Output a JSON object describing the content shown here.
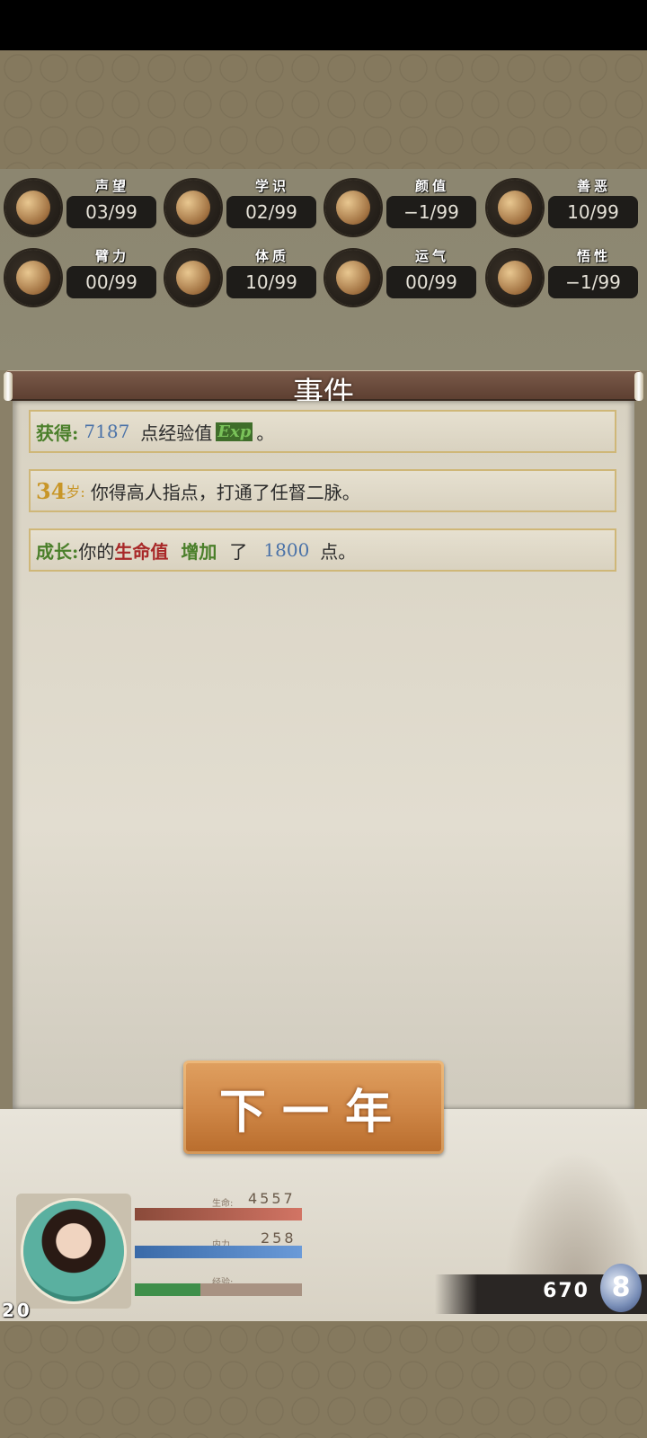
{
  "stats": [
    {
      "name": "声望",
      "value": "03/99",
      "icon": "reputation-icon"
    },
    {
      "name": "学识",
      "value": "02/99",
      "icon": "knowledge-icon"
    },
    {
      "name": "颜值",
      "value": "−1/99",
      "icon": "appearance-icon"
    },
    {
      "name": "善恶",
      "value": "10/99",
      "icon": "morality-icon"
    },
    {
      "name": "臂力",
      "value": "00/99",
      "icon": "strength-icon"
    },
    {
      "name": "体质",
      "value": "10/99",
      "icon": "constitution-icon"
    },
    {
      "name": "运气",
      "value": "00/99",
      "icon": "luck-icon"
    },
    {
      "name": "悟性",
      "value": "−1/99",
      "icon": "comprehension-icon"
    }
  ],
  "events_panel": {
    "title": "事件",
    "events": [
      {
        "prefix": "获得:",
        "num": "7187",
        "text1": "点经验值",
        "badge": "Exp",
        "text2": "。"
      },
      {
        "age": "34",
        "age_unit": "岁:",
        "text": "你得高人指点，打通了任督二脉。"
      },
      {
        "prefix": "成长:",
        "text1": "你的",
        "highlight": "生命值",
        "action": "增加",
        "text2": "了",
        "num": "1800",
        "text3": "点。"
      }
    ]
  },
  "next_button_label": "下一年",
  "character": {
    "level": "20",
    "hp_label": "生命:",
    "hp_value": "4557",
    "mp_label": "内力",
    "mp_value": "258",
    "exp_label": "经验:",
    "hp_fill": 1.0,
    "mp_fill": 1.0,
    "exp_fill": 0.39
  },
  "currency": {
    "value": "670",
    "icon": "silver-coin-icon"
  },
  "colors": {
    "hp": "#c8685a",
    "mp": "#5a8cc8",
    "exp": "#3f8f4a",
    "button": "#d08848"
  }
}
